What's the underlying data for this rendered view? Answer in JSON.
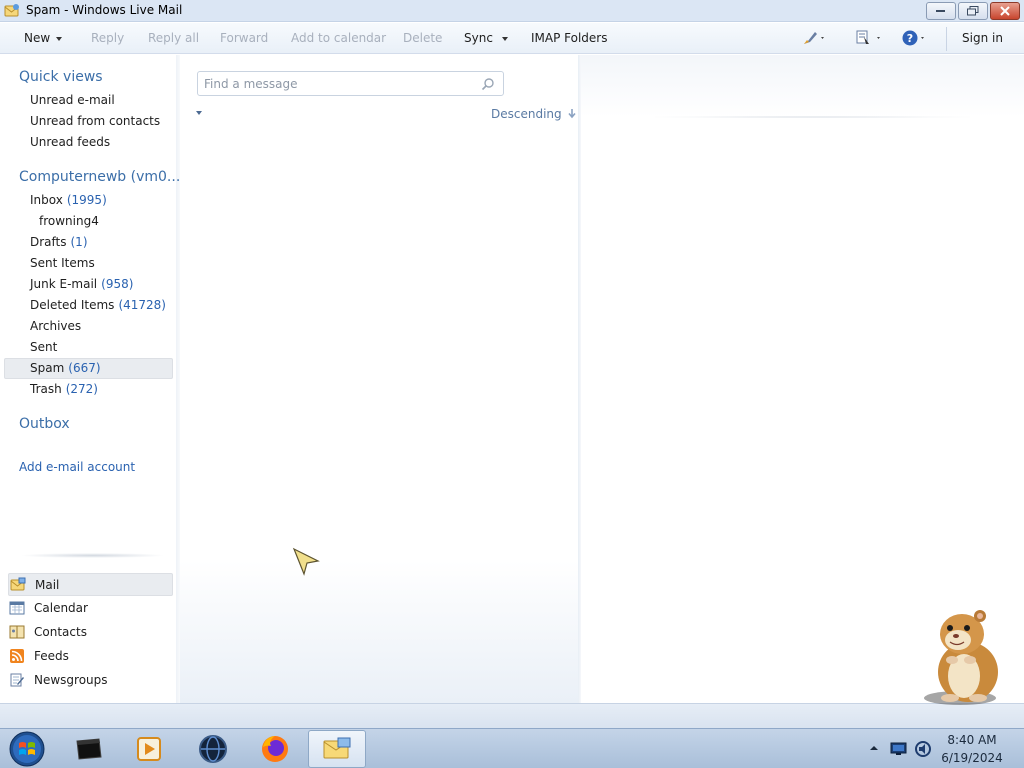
{
  "window": {
    "title": "Spam - Windows Live Mail"
  },
  "toolbar": {
    "new": "New",
    "reply": "Reply",
    "reply_all": "Reply all",
    "forward": "Forward",
    "add_to_calendar": "Add to calendar",
    "delete": "Delete",
    "sync": "Sync",
    "imap_folders": "IMAP Folders",
    "sign_in": "Sign in"
  },
  "quick_views": {
    "title": "Quick views",
    "items": [
      "Unread e-mail",
      "Unread from contacts",
      "Unread feeds"
    ]
  },
  "account": {
    "title": "Computernewb (vm0...",
    "folders": [
      {
        "name": "Inbox",
        "count": "(1995)"
      },
      {
        "name": "frowning4",
        "count": ""
      },
      {
        "name": "Drafts",
        "count": "(1)"
      },
      {
        "name": "Sent Items",
        "count": ""
      },
      {
        "name": "Junk E-mail",
        "count": "(958)"
      },
      {
        "name": "Deleted Items",
        "count": "(41728)"
      },
      {
        "name": "Archives",
        "count": ""
      },
      {
        "name": "Sent",
        "count": ""
      },
      {
        "name": "Spam",
        "count": "(667)"
      },
      {
        "name": "Trash",
        "count": "(272)"
      }
    ],
    "selected_folder": "Spam"
  },
  "outbox": {
    "title": "Outbox"
  },
  "add_account": "Add e-mail account",
  "modules": [
    {
      "label": "Mail",
      "icon": "mail-icon"
    },
    {
      "label": "Calendar",
      "icon": "calendar-icon"
    },
    {
      "label": "Contacts",
      "icon": "contacts-icon"
    },
    {
      "label": "Feeds",
      "icon": "rss-icon"
    },
    {
      "label": "Newsgroups",
      "icon": "newsgroups-icon"
    }
  ],
  "search": {
    "placeholder": "Find a message"
  },
  "sort": {
    "order": "Descending"
  },
  "taskbar": {
    "apps": [
      "terminal-icon",
      "media-player-icon",
      "web-browser-icon",
      "firefox-icon",
      "windows-live-mail-icon"
    ],
    "active_app": "windows-live-mail-icon"
  },
  "clock": {
    "time": "8:40 AM",
    "date": "6/19/2024"
  },
  "colors": {
    "accent": "#3b6ea8",
    "link": "#2a62b0",
    "disabled": "#a8b0bd"
  }
}
